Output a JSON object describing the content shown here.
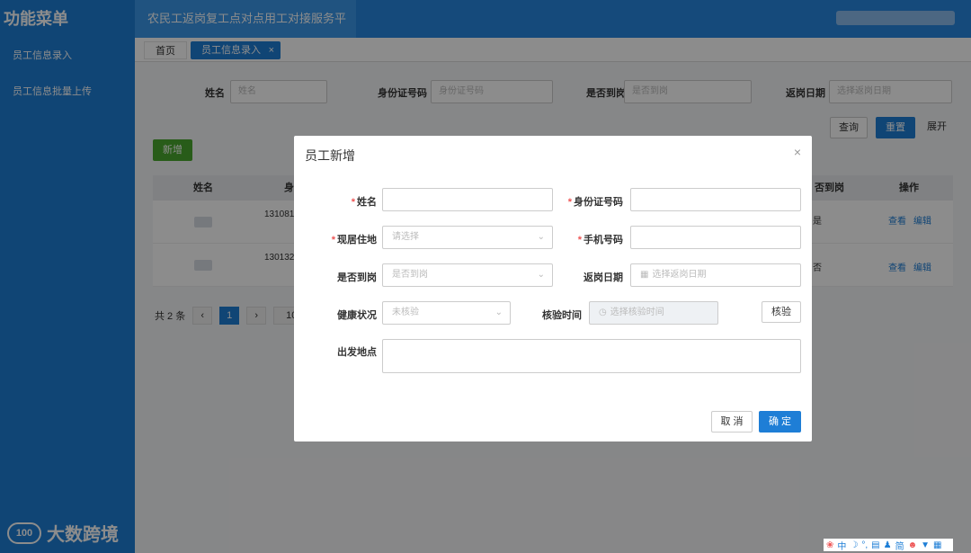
{
  "sidebar": {
    "title": "功能菜单",
    "items": [
      {
        "label": "员工信息录入"
      },
      {
        "label": "员工信息批量上传"
      }
    ],
    "watermark": "大数跨境"
  },
  "header": {
    "title": "农民工返岗复工点对点用工对接服务平台"
  },
  "tabs": [
    {
      "label": "首页"
    },
    {
      "label": "员工信息录入",
      "close": "×"
    }
  ],
  "filters": {
    "name_label": "姓名",
    "name_placeholder": "姓名",
    "id_label": "身份证号码",
    "id_placeholder": "身份证号码",
    "arrived_label": "是否到岗",
    "arrived_placeholder": "是否到岗",
    "return_label": "返岗日期",
    "return_placeholder": "选择返岗日期",
    "query_btn": "查询",
    "reset_btn": "重置",
    "expand_btn": "展开"
  },
  "toolbar": {
    "add_btn": "新增"
  },
  "table": {
    "col_name": "姓名",
    "col_id": "身",
    "col_arrived": "否到岗",
    "col_ops": "操作",
    "rows": [
      {
        "id": "131081",
        "arrived": "是",
        "view": "查看",
        "edit": "编辑"
      },
      {
        "id": "130132",
        "arrived": "否",
        "view": "查看",
        "edit": "编辑"
      }
    ]
  },
  "pager": {
    "total": "共 2 条",
    "current": "1",
    "size": "10"
  },
  "modal": {
    "title": "员工新增",
    "close": "×",
    "fields": {
      "name_label": "姓名",
      "id_label": "身份证号码",
      "residence_label": "现居住地",
      "residence_placeholder": "请选择",
      "phone_label": "手机号码",
      "arrived_label": "是否到岗",
      "arrived_placeholder": "是否到岗",
      "return_label": "返岗日期",
      "return_placeholder": "选择返岗日期",
      "health_label": "健康状况",
      "health_placeholder": "未核验",
      "verify_time_label": "核验时间",
      "verify_time_placeholder": "选择核验时间",
      "verify_btn": "核验",
      "origin_label": "出发地点"
    },
    "cancel_btn": "取 消",
    "confirm_btn": "确 定"
  },
  "tray": {
    "items": [
      "中",
      "简"
    ]
  }
}
